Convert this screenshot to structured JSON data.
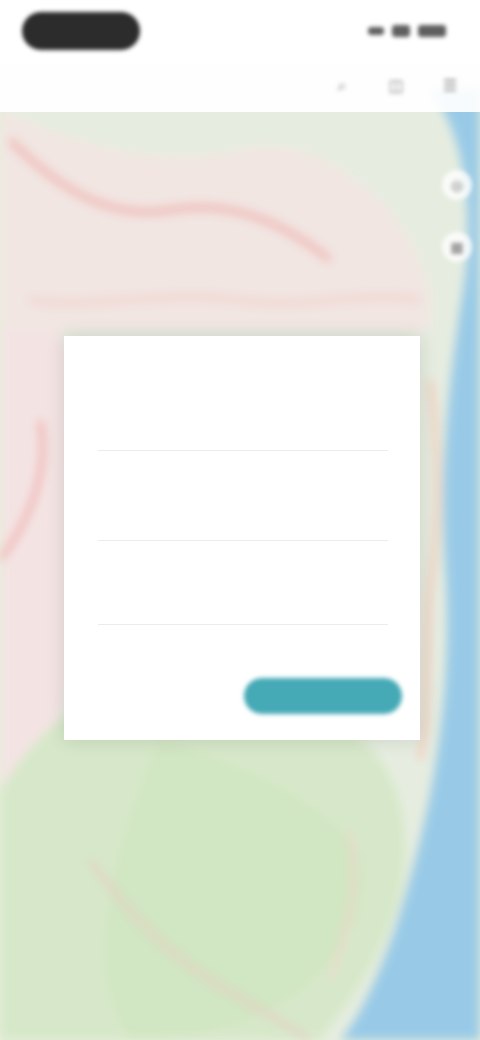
{
  "app": {
    "title": "",
    "header_icons": [
      "search-icon",
      "layers-icon",
      "menu-icon"
    ]
  },
  "map": {
    "land_color": "#dfe9d3",
    "water_color": "#8ec7e6",
    "road_color": "#f2b8b1"
  },
  "dialog": {
    "title": "",
    "subtitle": "",
    "fields": [
      {
        "label": ""
      },
      {
        "label": ""
      },
      {
        "label": ""
      }
    ],
    "cancel_label": "",
    "confirm_label": "",
    "accent_color": "#45aab6",
    "title_color": "#e36a55"
  }
}
